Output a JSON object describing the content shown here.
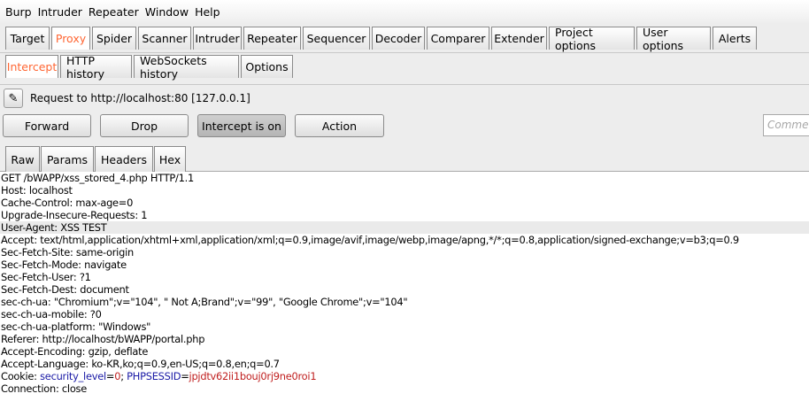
{
  "menubar": [
    "Burp",
    "Intruder",
    "Repeater",
    "Window",
    "Help"
  ],
  "main_tabs": [
    {
      "label": "Target",
      "active": false
    },
    {
      "label": "Proxy",
      "active": true
    },
    {
      "label": "Spider",
      "active": false
    },
    {
      "label": "Scanner",
      "active": false
    },
    {
      "label": "Intruder",
      "active": false
    },
    {
      "label": "Repeater",
      "active": false
    },
    {
      "label": "Sequencer",
      "active": false
    },
    {
      "label": "Decoder",
      "active": false
    },
    {
      "label": "Comparer",
      "active": false
    },
    {
      "label": "Extender",
      "active": false
    },
    {
      "label": "Project options",
      "active": false
    },
    {
      "label": "User options",
      "active": false
    },
    {
      "label": "Alerts",
      "active": false
    }
  ],
  "proxy_tabs": [
    {
      "label": "Intercept",
      "active": true
    },
    {
      "label": "HTTP history",
      "active": false
    },
    {
      "label": "WebSockets history",
      "active": false
    },
    {
      "label": "Options",
      "active": false
    }
  ],
  "request_info": "Request to http://localhost:80  [127.0.0.1]",
  "buttons": {
    "forward": "Forward",
    "drop": "Drop",
    "intercept": "Intercept is on",
    "action": "Action"
  },
  "comment_placeholder": "Comment",
  "view_tabs": [
    {
      "label": "Raw",
      "active": true
    },
    {
      "label": "Params",
      "active": false
    },
    {
      "label": "Headers",
      "active": false
    },
    {
      "label": "Hex",
      "active": false
    }
  ],
  "request_lines": [
    "GET /bWAPP/xss_stored_4.php HTTP/1.1",
    "Host: localhost",
    "Cache-Control: max-age=0",
    "Upgrade-Insecure-Requests: 1",
    "User-Agent: XSS TEST",
    "Accept: text/html,application/xhtml+xml,application/xml;q=0.9,image/avif,image/webp,image/apng,*/*;q=0.8,application/signed-exchange;v=b3;q=0.9",
    "Sec-Fetch-Site: same-origin",
    "Sec-Fetch-Mode: navigate",
    "Sec-Fetch-User: ?1",
    "Sec-Fetch-Dest: document",
    "sec-ch-ua: \"Chromium\";v=\"104\", \" Not A;Brand\";v=\"99\", \"Google Chrome\";v=\"104\"",
    "sec-ch-ua-mobile: ?0",
    "sec-ch-ua-platform: \"Windows\"",
    "Referer: http://localhost/bWAPP/portal.php",
    "Accept-Encoding: gzip, deflate",
    "Accept-Language: ko-KR,ko;q=0.9,en-US;q=0.8,en;q=0.7"
  ],
  "cookie_line": {
    "prefix": "Cookie: ",
    "name1": "security_level",
    "eq1": "=",
    "val1": "0",
    "sep": "; ",
    "name2": "PHPSESSID",
    "eq2": "=",
    "val2": "jpjdtv62ii1bouj0rj9ne0roi1"
  },
  "last_line": "Connection: close",
  "colors": {
    "active_tab": "#ff6633",
    "cookie_name": "#1a1aa6",
    "cookie_value": "#c02020"
  }
}
